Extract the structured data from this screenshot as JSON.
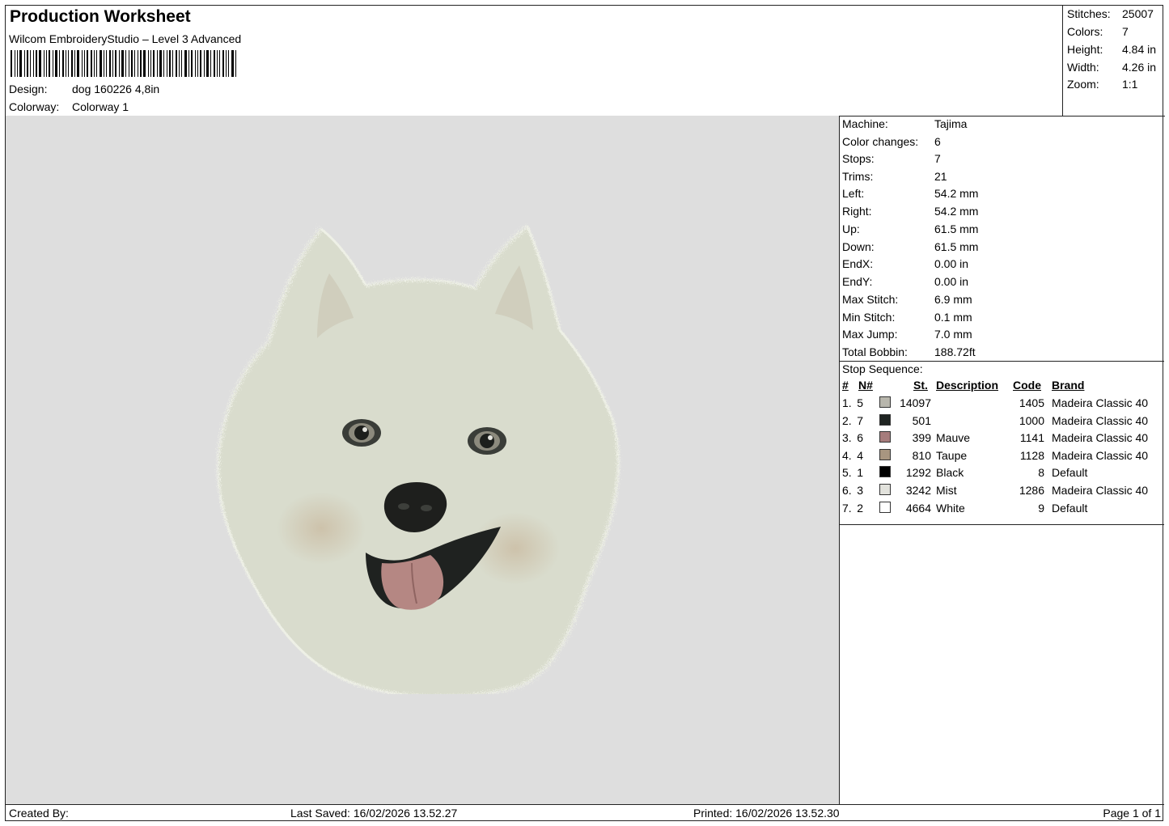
{
  "header": {
    "title": "Production Worksheet",
    "software": "Wilcom EmbroideryStudio – Level 3 Advanced",
    "design_label": "Design:",
    "design_value": "dog 160226 4,8in",
    "colorway_label": "Colorway:",
    "colorway_value": "Colorway 1"
  },
  "summary": {
    "stitches_label": "Stitches:",
    "stitches": "25007",
    "colors_label": "Colors:",
    "colors": "7",
    "height_label": "Height:",
    "height": "4.84 in",
    "width_label": "Width:",
    "width": "4.26 in",
    "zoom_label": "Zoom:",
    "zoom": "1:1"
  },
  "machine_info": {
    "machine_label": "Machine:",
    "machine": "Tajima",
    "color_changes_label": "Color changes:",
    "color_changes": "6",
    "stops_label": "Stops:",
    "stops": "7",
    "trims_label": "Trims:",
    "trims": "21",
    "left_label": "Left:",
    "left": "54.2 mm",
    "right_label": "Right:",
    "right": "54.2 mm",
    "up_label": "Up:",
    "up": "61.5 mm",
    "down_label": "Down:",
    "down": "61.5 mm",
    "endx_label": "EndX:",
    "endx": "0.00 in",
    "endy_label": "EndY:",
    "endy": "0.00 in",
    "max_stitch_label": "Max Stitch:",
    "max_stitch": "6.9 mm",
    "min_stitch_label": "Min Stitch:",
    "min_stitch": "0.1 mm",
    "max_jump_label": "Max Jump:",
    "max_jump": "7.0 mm",
    "total_bobbin_label": "Total Bobbin:",
    "total_bobbin": "188.72ft"
  },
  "stop_sequence": {
    "title": "Stop Sequence:",
    "headers": [
      "#",
      "N#",
      "St.",
      "Description",
      "Code",
      "Brand"
    ],
    "rows": [
      {
        "num": "1.",
        "n": "5",
        "st": "14097",
        "desc": "",
        "code": "1405",
        "brand": "Madeira Classic 40",
        "color": "#b8b6ac"
      },
      {
        "num": "2.",
        "n": "7",
        "st": "501",
        "desc": "",
        "code": "1000",
        "brand": "Madeira Classic 40",
        "color": "#1f2422"
      },
      {
        "num": "3.",
        "n": "6",
        "st": "399",
        "desc": "Mauve",
        "code": "1141",
        "brand": "Madeira Classic 40",
        "color": "#a67c7c"
      },
      {
        "num": "4.",
        "n": "4",
        "st": "810",
        "desc": "Taupe",
        "code": "1128",
        "brand": "Madeira Classic 40",
        "color": "#a89680"
      },
      {
        "num": "5.",
        "n": "1",
        "st": "1292",
        "desc": "Black",
        "code": "8",
        "brand": "Default",
        "color": "#000000"
      },
      {
        "num": "6.",
        "n": "3",
        "st": "3242",
        "desc": "Mist",
        "code": "1286",
        "brand": "Madeira Classic 40",
        "color": "#e2e2dc"
      },
      {
        "num": "7.",
        "n": "2",
        "st": "4664",
        "desc": "White",
        "code": "9",
        "brand": "Default",
        "color": "#ffffff"
      }
    ]
  },
  "footer": {
    "created_by": "Created By:",
    "last_saved": "Last Saved: 16/02/2026 13.52.27",
    "printed": "Printed: 16/02/2026 13.52.30",
    "page": "Page 1 of 1"
  },
  "preview": {
    "icon": "embroidered-dog-face",
    "background": "#dedede",
    "fur_color": "#d9dccd"
  }
}
